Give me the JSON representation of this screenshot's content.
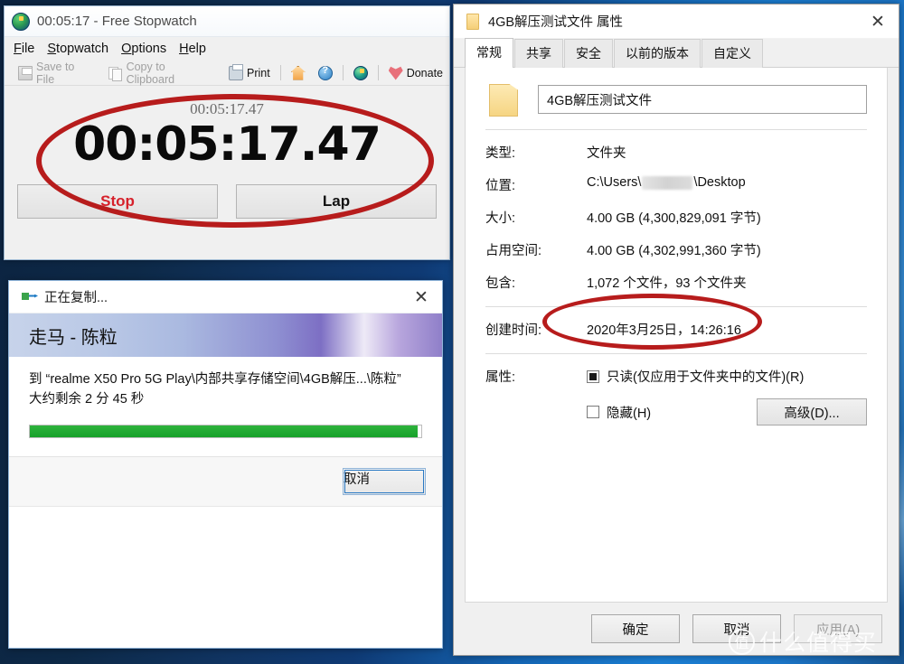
{
  "desktop": {
    "background_color": "#0d2947",
    "accent_color": "#1b7fd4"
  },
  "watermark": {
    "logo_glyph": "值",
    "text": "什么值得买"
  },
  "stopwatch": {
    "title": "00:05:17 - Free Stopwatch",
    "icon": "stopwatch-icon",
    "menu": [
      {
        "label": "File",
        "accel": "F"
      },
      {
        "label": "Stopwatch",
        "accel": "S"
      },
      {
        "label": "Options",
        "accel": "O"
      },
      {
        "label": "Help",
        "accel": "H"
      }
    ],
    "toolbar": [
      {
        "label": "Save to File",
        "icon": "save-icon",
        "disabled": true
      },
      {
        "label": "Copy to Clipboard",
        "icon": "copy-icon",
        "disabled": true
      },
      {
        "label": "Print",
        "icon": "print-icon",
        "disabled": false
      },
      {
        "label": "Home",
        "icon": "home-icon",
        "disabled": false
      },
      {
        "label": "Help",
        "icon": "help-icon",
        "disabled": false
      },
      {
        "label": "Stopwatch",
        "icon": "stopwatch-icon",
        "disabled": false
      },
      {
        "label": "Donate",
        "icon": "heart-icon",
        "disabled": false
      }
    ],
    "small_time": "00:05:17.47",
    "big_time": "00:05:17.47",
    "buttons": {
      "stop": "Stop",
      "lap": "Lap"
    },
    "annotation_color": "#b71c1c"
  },
  "copy_dialog": {
    "title": "正在复制...",
    "close_label": "✕",
    "song": "走马 - 陈粒",
    "destination_line": "到 “realme X50 Pro 5G Play\\内部共享存储空间\\4GB解压...\\陈粒”",
    "remaining_line": "大约剩余 2 分 45 秒",
    "progress_percent": 99,
    "progress_color": "#22a636",
    "cancel_label": "取消"
  },
  "properties": {
    "title": "4GB解压测试文件 属性",
    "close_label": "✕",
    "tabs": [
      {
        "label": "常规",
        "active": true
      },
      {
        "label": "共享",
        "active": false
      },
      {
        "label": "安全",
        "active": false
      },
      {
        "label": "以前的版本",
        "active": false
      },
      {
        "label": "自定义",
        "active": false
      }
    ],
    "name_value": "4GB解压测试文件",
    "fields": [
      {
        "label": "类型:",
        "value": "文件夹"
      },
      {
        "label": "大小:",
        "value": "4.00 GB (4,300,829,091 字节)"
      },
      {
        "label": "占用空间:",
        "value": "4.00 GB (4,302,991,360 字节)"
      },
      {
        "label": "包含:",
        "value": "1,072 个文件，93 个文件夹"
      },
      {
        "label": "创建时间:",
        "value": "2020年3月25日，14:26:16"
      }
    ],
    "location": {
      "label": "位置:",
      "prefix": "C:\\Users\\",
      "suffix": "\\Desktop",
      "redacted": true
    },
    "attributes": {
      "label": "属性:",
      "readonly_label": "只读(仅应用于文件夹中的文件)(R)",
      "readonly_state": "indeterminate",
      "hidden_label": "隐藏(H)",
      "hidden_state": "unchecked",
      "advanced_label": "高级(D)..."
    },
    "footer_buttons": [
      {
        "label": "确定",
        "disabled": false
      },
      {
        "label": "取消",
        "disabled": false
      },
      {
        "label": "应用(A)",
        "disabled": true
      }
    ]
  }
}
